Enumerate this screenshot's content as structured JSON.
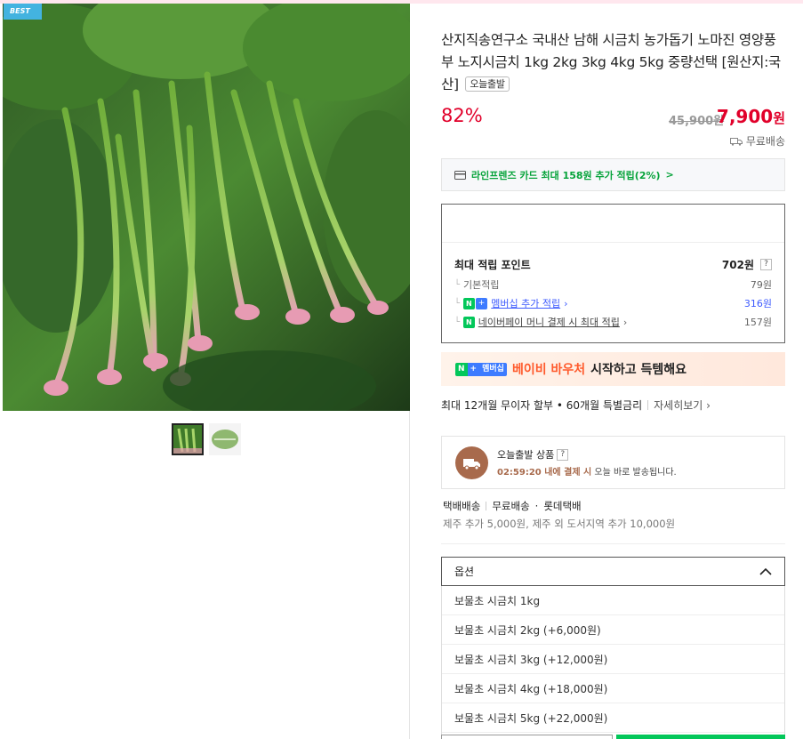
{
  "badge": {
    "best": "BEST"
  },
  "product": {
    "title": "산지직송연구소 국내산 남해 시금치 농가돕기 노마진 영양풍부 노지시금치 1kg 2kg 3kg 4kg 5kg 중량선택 [원산지:국산]",
    "today_chip": "오늘출발",
    "discount": "82%",
    "original_price": "45,900원",
    "sale_price": "7,900",
    "sale_unit": "원",
    "free_shipping": "무료배송"
  },
  "card_promo": {
    "text": "라인프렌즈 카드 최대 158원 추가 적립(2%)",
    "chevron": ">"
  },
  "points": {
    "title": "최대 적립 포인트",
    "total": "702원",
    "help": "?",
    "rows": [
      {
        "label": "기본적립",
        "value": "79원"
      },
      {
        "badge": "N",
        "plus": "+",
        "label": "멤버십 추가 적립",
        "value": "316원"
      },
      {
        "badge": "N",
        "label": "네이버페이 머니 결제 시 최대 적립",
        "value": "157원"
      }
    ]
  },
  "voucher": {
    "badge_n": "N",
    "badge_plus": "+",
    "badge_text": "멤버십",
    "highlight": "베이비 바우처",
    "rest": "시작하고 득템해요"
  },
  "installment": {
    "text": "최대 12개월 무이자 할부 • 60개월 특별금리",
    "detail": "자세히보기"
  },
  "today_ship": {
    "title": "오늘출발 상품",
    "help": "?",
    "timer": "02:59:20",
    "desc_mid": " 내에 결제 시",
    "desc_end": " 오늘 바로 발송됩니다."
  },
  "shipping": {
    "method": "택배배송",
    "fee": "무료배송",
    "courier": "롯데택배",
    "extra": "제주 추가 5,000원, 제주 외 도서지역 추가 10,000원"
  },
  "options": {
    "label": "옵션",
    "items": [
      "보물초 시금치 1kg",
      "보물초 시금치 2kg (+6,000원)",
      "보물초 시금치 3kg (+12,000원)",
      "보물초 시금치 4kg (+18,000원)",
      "보물초 시금치 5kg (+22,000원)"
    ]
  },
  "colors": {
    "accent_red": "#e1002a",
    "naver_green": "#03c75a",
    "member_blue": "#3d7bff"
  }
}
